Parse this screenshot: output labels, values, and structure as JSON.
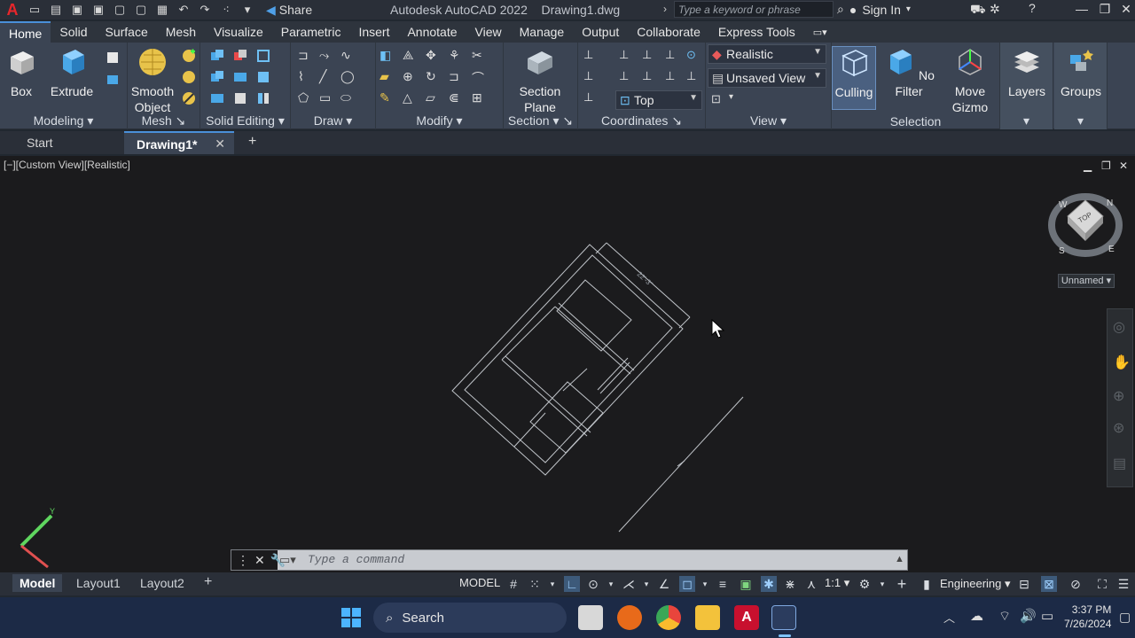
{
  "titlebar": {
    "app_title": "Autodesk AutoCAD 2022",
    "file_name": "Drawing1.dwg",
    "share_label": "Share",
    "search_placeholder": "Type a keyword or phrase",
    "signin_label": "Sign In"
  },
  "ribbon_tabs": [
    "Home",
    "Solid",
    "Surface",
    "Mesh",
    "Visualize",
    "Parametric",
    "Insert",
    "Annotate",
    "View",
    "Manage",
    "Output",
    "Collaborate",
    "Express Tools"
  ],
  "ribbon": {
    "modeling": {
      "label": "Modeling",
      "box": "Box",
      "extrude": "Extrude"
    },
    "mesh": {
      "label": "Mesh",
      "smooth_object": "Smooth Object"
    },
    "solid_editing": {
      "label": "Solid Editing"
    },
    "draw": {
      "label": "Draw"
    },
    "modify": {
      "label": "Modify"
    },
    "section": {
      "label": "Section",
      "section_plane": "Section Plane"
    },
    "coordinates": {
      "label": "Coordinates",
      "ucs_view": "Top"
    },
    "view": {
      "label": "View",
      "visual_style": "Realistic",
      "named_view": "Unsaved View"
    },
    "selection": {
      "label": "Selection",
      "culling": "Culling",
      "no_filter": "No Filter",
      "move_gizmo": "Move Gizmo"
    },
    "layers": "Layers",
    "groups": "Groups"
  },
  "file_tabs": {
    "start": "Start",
    "drawing": "Drawing1*"
  },
  "viewport": {
    "label": "[−][Custom View][Realistic]",
    "viewcube_face": "TOP",
    "compass": {
      "n": "N",
      "w": "W",
      "s": "S",
      "e": "E"
    },
    "ucs_name": "Unnamed",
    "dimension_text": "22'-3\""
  },
  "command_line": {
    "placeholder": "Type a command"
  },
  "status": {
    "model_tab": "Model",
    "layout1": "Layout1",
    "layout2": "Layout2",
    "model_btn": "MODEL",
    "scale": "1:1",
    "workspace": "Engineering"
  },
  "taskbar": {
    "search_label": "Search",
    "time": "3:37 PM",
    "date": "7/26/2024"
  },
  "colors": {
    "accent": "#4a90d9",
    "viewport_bg": "#1b1b1d",
    "drawing_lines": "#bfc3c8",
    "autocad_red": "#e8262b"
  }
}
